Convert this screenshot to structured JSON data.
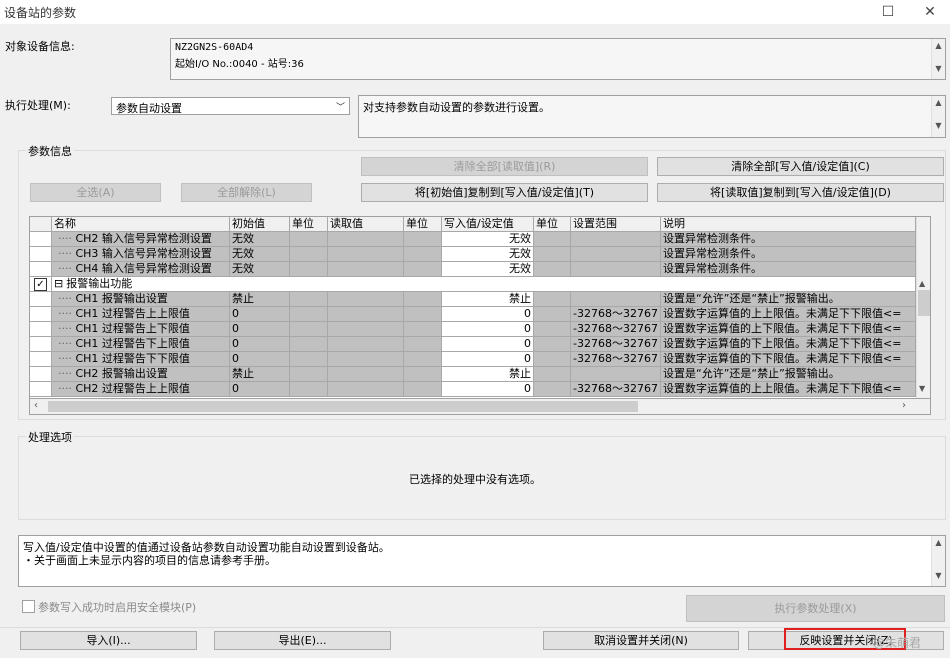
{
  "window": {
    "title": "设备站的参数",
    "maximize_icon": "maximize-icon",
    "close_icon": "close-icon"
  },
  "target_info": {
    "label": "对象设备信息:",
    "line1": "NZ2GN2S-60AD4",
    "line2": "起始I/O No.:0040 - 站号:36"
  },
  "process": {
    "label": "执行处理(M):",
    "selected": "参数自动设置",
    "description": "对支持参数自动设置的参数进行设置。"
  },
  "param_info": {
    "label": "参数信息",
    "clear_read": "清除全部[读取值](R)",
    "clear_write": "清除全部[写入值/设定值](C)",
    "select_all": "全选(A)",
    "deselect_all": "全部解除(L)",
    "copy_initial": "将[初始值]复制到[写入值/设定值](T)",
    "copy_read": "将[读取值]复制到[写入值/设定值](D)"
  },
  "grid": {
    "headers": [
      "名称",
      "初始值",
      "单位",
      "读取值",
      "单位",
      "写入值/设定值",
      "单位",
      "设置范围",
      "说明"
    ],
    "rows": [
      {
        "name": "CH2 输入信号异常检测设置",
        "init": "无效",
        "write": "无效",
        "range": "",
        "desc": "设置异常检测条件。"
      },
      {
        "name": "CH3 输入信号异常检测设置",
        "init": "无效",
        "write": "无效",
        "range": "",
        "desc": "设置异常检测条件。"
      },
      {
        "name": "CH4 输入信号异常检测设置",
        "init": "无效",
        "write": "无效",
        "range": "",
        "desc": "设置异常检测条件。"
      },
      {
        "group": true,
        "name": "报警输出功能",
        "collapse_symbol": "⊟",
        "check_symbol": "✓"
      },
      {
        "name": "CH1 报警输出设置",
        "init": "禁止",
        "write": "禁止",
        "range": "",
        "desc": "设置是“允许”还是“禁止”报警输出。"
      },
      {
        "name": "CH1 过程警告上上限值",
        "init": "0",
        "write": "0",
        "range": "-32768～32767",
        "desc": "设置数字运算值的上上限值。未满足下下限值<="
      },
      {
        "name": "CH1 过程警告上下限值",
        "init": "0",
        "write": "0",
        "range": "-32768～32767",
        "desc": "设置数字运算值的上下限值。未满足下下限值<="
      },
      {
        "name": "CH1 过程警告下上限值",
        "init": "0",
        "write": "0",
        "range": "-32768～32767",
        "desc": "设置数字运算值的下上限值。未满足下下限值<="
      },
      {
        "name": "CH1 过程警告下下限值",
        "init": "0",
        "write": "0",
        "range": "-32768～32767",
        "desc": "设置数字运算值的下下限值。未满足下下限值<="
      },
      {
        "name": "CH2 报警输出设置",
        "init": "禁止",
        "write": "禁止",
        "range": "",
        "desc": "设置是“允许”还是“禁止”报警输出。"
      },
      {
        "name": "CH2 过程警告上上限值",
        "init": "0",
        "write": "0",
        "range": "-32768～32767",
        "desc": "设置数字运算值的上上限值。未满足下下限值<="
      }
    ]
  },
  "process_options": {
    "label": "处理选项",
    "message": "已选择的处理中没有选项。"
  },
  "info_text": {
    "line1": "写入值/设定值中设置的值通过设备站参数自动设置功能自动设置到设备站。",
    "line2": "・关于画面上未显示内容的项目的信息请参考手册。"
  },
  "safety_checkbox": "参数写入成功时启用安全模块(P)",
  "execute_button": "执行参数处理(X)",
  "footer": {
    "import": "导入(I)...",
    "export": "导出(E)...",
    "cancel": "取消设置并关闭(N)",
    "apply": "反映设置并关闭(Z)",
    "watermark": "@朱萌君"
  },
  "colors": {
    "highlight": "#e02020",
    "grid_gray": "#c0c0c0"
  }
}
